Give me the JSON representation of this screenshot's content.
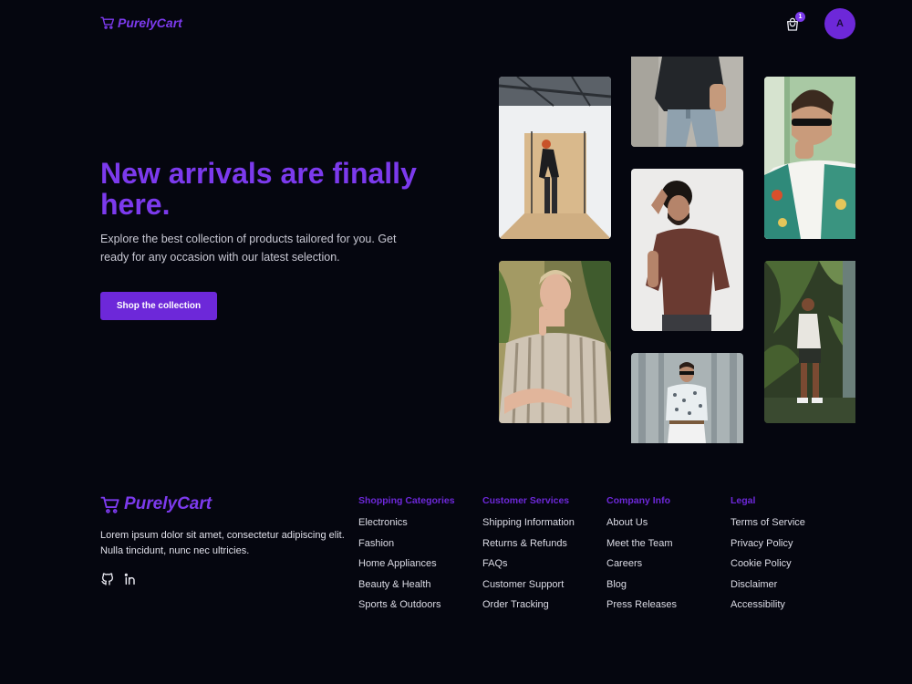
{
  "header": {
    "brand": "PurelyCart",
    "cart_count": "1",
    "avatar_initial": "A"
  },
  "hero": {
    "title": "New arrivals are finally here.",
    "subtitle": "Explore the best collection of products tailored for you. Get ready for any occasion with our latest selection.",
    "cta_label": "Shop the collection"
  },
  "gallery": {
    "photos": [
      "studio-portrait",
      "dark-sweater-jeans",
      "sunglasses-floral-shirt",
      "curly-hair-brown-tee",
      "striped-shirt-portrait",
      "sunglasses-patterned-shirt",
      "garden-full-body"
    ]
  },
  "footer": {
    "brand": "PurelyCart",
    "description": "Lorem ipsum dolor sit amet, consectetur adipiscing elit. Nulla tincidunt, nunc nec ultricies.",
    "socials": [
      "github-icon",
      "linkedin-icon"
    ],
    "columns": [
      {
        "title": "Shopping Categories",
        "links": [
          "Electronics",
          "Fashion",
          "Home Appliances",
          "Beauty & Health",
          "Sports & Outdoors"
        ]
      },
      {
        "title": "Customer Services",
        "links": [
          "Shipping Information",
          "Returns & Refunds",
          "FAQs",
          "Customer Support",
          "Order Tracking"
        ]
      },
      {
        "title": "Company Info",
        "links": [
          "About Us",
          "Meet the Team",
          "Careers",
          "Blog",
          "Press Releases"
        ]
      },
      {
        "title": "Legal",
        "links": [
          "Terms of Service",
          "Privacy Policy",
          "Cookie Policy",
          "Disclaimer",
          "Accessibility"
        ]
      }
    ]
  },
  "colors": {
    "background": "#05060f",
    "accent": "#7c3aed",
    "accent_dark": "#6d28d9"
  }
}
